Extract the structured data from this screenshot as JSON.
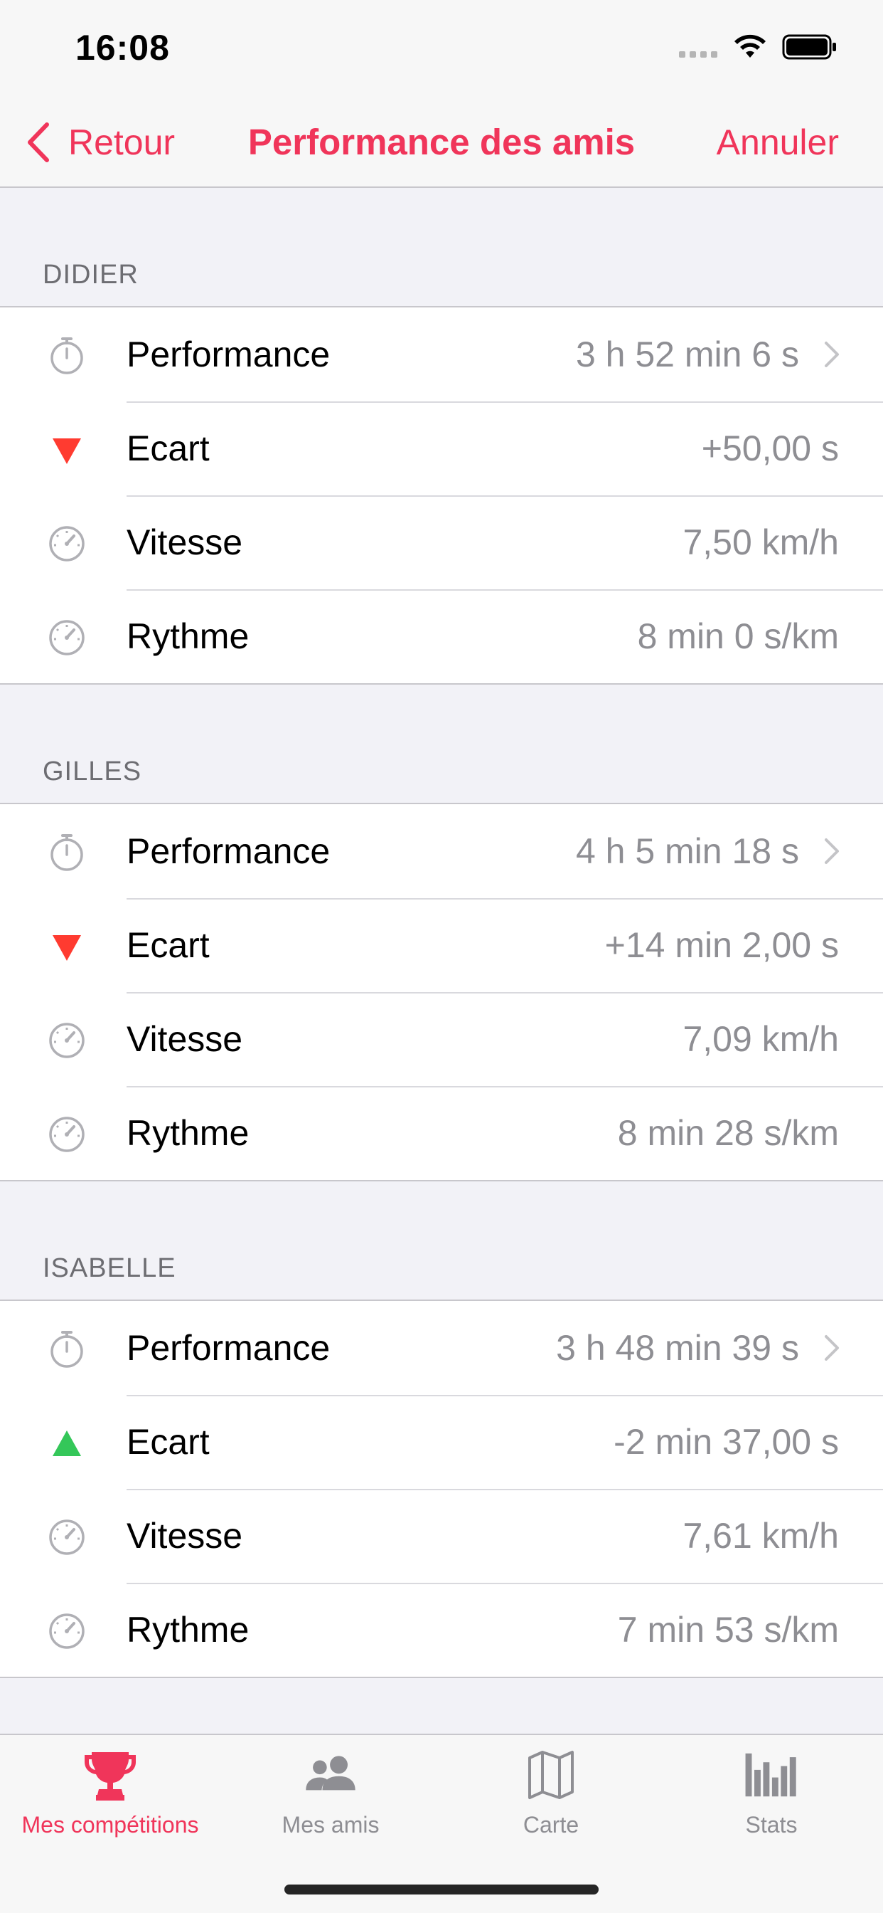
{
  "status_bar": {
    "time": "16:08"
  },
  "nav": {
    "back_label": "Retour",
    "title": "Performance des amis",
    "cancel_label": "Annuler"
  },
  "sections": [
    {
      "name": "DIDIER",
      "rows": [
        {
          "icon": "stopwatch-icon",
          "label": "Performance",
          "value": "3 h 52 min 6 s",
          "chevron": true
        },
        {
          "icon": "red-down-triangle-icon",
          "label": "Ecart",
          "value": "+50,00 s"
        },
        {
          "icon": "speedometer-icon",
          "label": "Vitesse",
          "value": "7,50 km/h"
        },
        {
          "icon": "speedometer-icon",
          "label": "Rythme",
          "value": "8 min 0 s/km"
        }
      ]
    },
    {
      "name": "GILLES",
      "rows": [
        {
          "icon": "stopwatch-icon",
          "label": "Performance",
          "value": "4 h 5 min 18 s",
          "chevron": true
        },
        {
          "icon": "red-down-triangle-icon",
          "label": "Ecart",
          "value": "+14 min 2,00 s"
        },
        {
          "icon": "speedometer-icon",
          "label": "Vitesse",
          "value": "7,09 km/h"
        },
        {
          "icon": "speedometer-icon",
          "label": "Rythme",
          "value": "8 min 28 s/km"
        }
      ]
    },
    {
      "name": "ISABELLE",
      "rows": [
        {
          "icon": "stopwatch-icon",
          "label": "Performance",
          "value": "3 h 48 min 39 s",
          "chevron": true
        },
        {
          "icon": "green-up-triangle-icon",
          "label": "Ecart",
          "value": "-2 min 37,00 s"
        },
        {
          "icon": "speedometer-icon",
          "label": "Vitesse",
          "value": "7,61 km/h"
        },
        {
          "icon": "speedometer-icon",
          "label": "Rythme",
          "value": "7 min 53 s/km"
        }
      ]
    }
  ],
  "tabbar": {
    "tabs": [
      {
        "label": "Mes compétitions",
        "icon": "trophy-icon",
        "active": true
      },
      {
        "label": "Mes amis",
        "icon": "people-icon",
        "active": false
      },
      {
        "label": "Carte",
        "icon": "map-icon",
        "active": false
      },
      {
        "label": "Stats",
        "icon": "bar-chart-icon",
        "active": false
      }
    ]
  },
  "colors": {
    "accent": "#f0355a",
    "red": "#ff3b30",
    "green": "#34c759",
    "secondary_text": "#8e8e93",
    "background": "#f2f2f7"
  }
}
